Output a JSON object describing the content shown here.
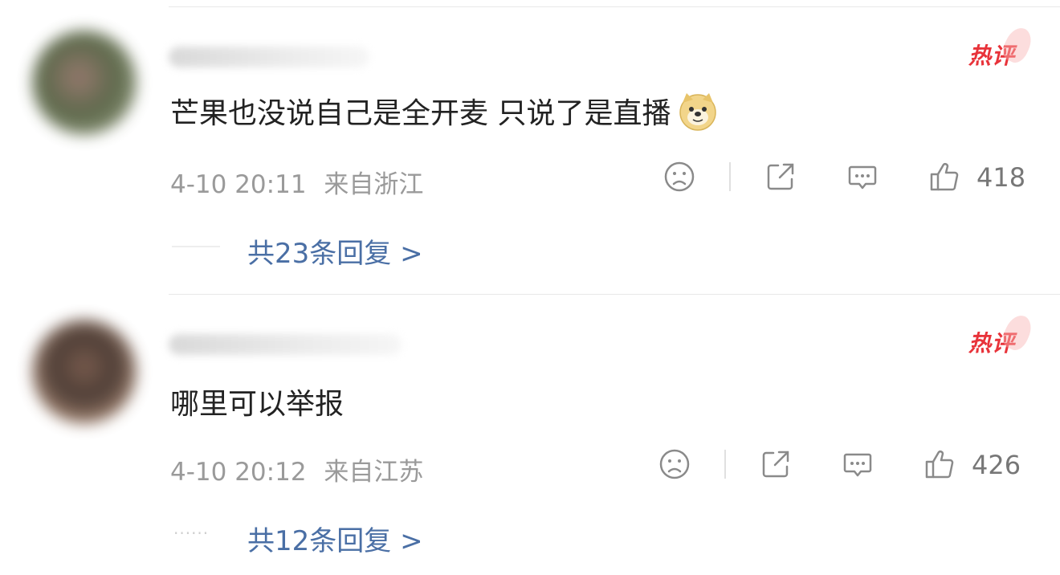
{
  "comments": [
    {
      "badge": "热评",
      "text": "芒果也没说自己是全开麦 只说了是直播",
      "emoji": "doge-emoji",
      "time": "4-10 20:11",
      "location": "来自浙江",
      "likes": "418",
      "replies": "共23条回复 >"
    },
    {
      "badge": "热评",
      "text": "哪里可以举报",
      "emoji": "",
      "time": "4-10 20:12",
      "location": "来自江苏",
      "likes": "426",
      "replies": "共12条回复 >",
      "replies_prefix": "······"
    }
  ],
  "icons": {
    "dislike": "sad-face-icon",
    "share": "share-icon",
    "comment": "comment-bubble-icon",
    "like": "thumbs-up-icon"
  },
  "colors": {
    "hot": "#e8333a",
    "link": "#4a6fa5",
    "meta": "#9a9a9a"
  }
}
